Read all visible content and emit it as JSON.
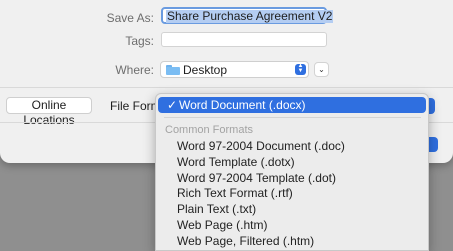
{
  "save_as": {
    "label": "Save As:",
    "value": "Share Purchase Agreement V2"
  },
  "tags": {
    "label": "Tags:",
    "value": ""
  },
  "where": {
    "label": "Where:",
    "value": "Desktop"
  },
  "online_locations": "Online Locations",
  "file_format_label": "File Forma",
  "menu": {
    "selected": "Word Document (.docx)",
    "check": "✓",
    "section_header": "Common Formats",
    "items": [
      "Word 97-2004 Document (.doc)",
      "Word Template (.dotx)",
      "Word 97-2004 Template (.dot)",
      "Rich Text Format (.rtf)",
      "Plain Text (.txt)",
      "Web Page (.htm)",
      "Web Page, Filtered (.htm)"
    ]
  }
}
